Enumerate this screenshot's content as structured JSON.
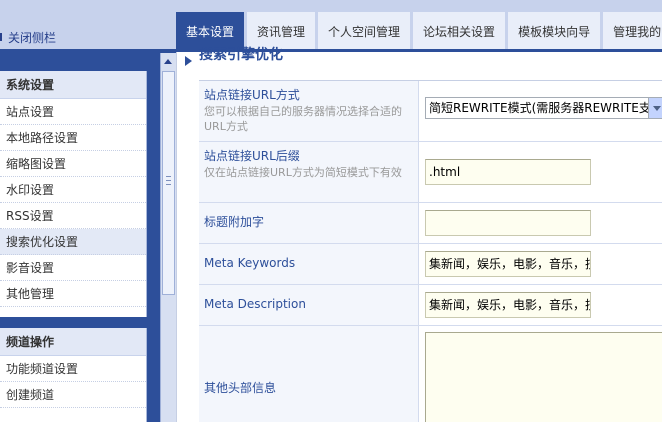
{
  "header": {
    "toggle_label": "关闭侧栏",
    "tabs": [
      {
        "label": "基本设置",
        "active": true
      },
      {
        "label": "资讯管理",
        "active": false
      },
      {
        "label": "个人空间管理",
        "active": false
      },
      {
        "label": "论坛相关设置",
        "active": false
      },
      {
        "label": "模板模块向导",
        "active": false
      },
      {
        "label": "管理我的",
        "active": false
      }
    ]
  },
  "sidebar": {
    "groups": [
      {
        "title": "系统设置",
        "items": [
          "站点设置",
          "本地路径设置",
          "缩略图设置",
          "水印设置",
          "RSS设置",
          "搜索优化设置",
          "影音设置",
          "其他管理"
        ],
        "active_index": 5
      },
      {
        "title": "频道操作",
        "items": [
          "功能频道设置",
          "创建频道"
        ]
      }
    ]
  },
  "main": {
    "section_title": "搜索引擎优化",
    "rows": [
      {
        "label": "站点链接URL方式",
        "desc": "您可以根据自己的服务器情况选择合适的URL方式",
        "type": "select",
        "value": "简短REWRITE模式(需服务器REWRITE支持)"
      },
      {
        "label": "站点链接URL后缀",
        "desc": "仅在站点链接URL方式为简短模式下有效",
        "type": "input",
        "value": ".html"
      },
      {
        "label": "标题附加字",
        "desc": "",
        "type": "input",
        "value": ""
      },
      {
        "label": "Meta Keywords",
        "desc": "",
        "type": "input",
        "value": "集新闻，娱乐，电影，音乐，技术"
      },
      {
        "label": "Meta Description",
        "desc": "",
        "type": "input",
        "value": "集新闻，娱乐，电影，音乐，技术"
      },
      {
        "label": "其他头部信息",
        "desc": "",
        "type": "textarea",
        "value": ""
      }
    ]
  },
  "colors": {
    "accent": "#2d4f9a",
    "header_bg": "#c7d2ec",
    "label_bg": "#f3f6fc",
    "input_bg": "#fefef0"
  },
  "icons": {
    "toggle": "sidebar-toggle-icon",
    "section": "triangle-right-icon",
    "scroll_up": "scroll-up-icon"
  }
}
